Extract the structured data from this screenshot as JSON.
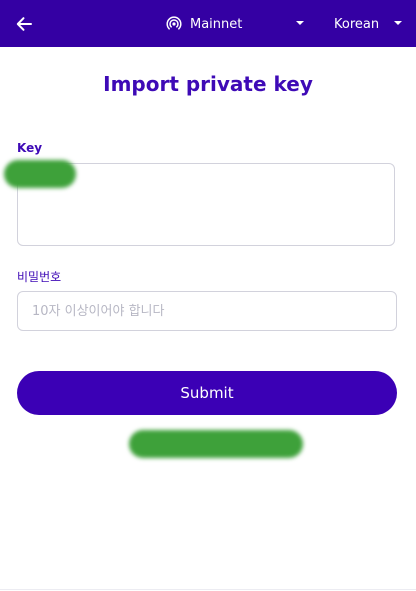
{
  "header": {
    "back_icon": "arrow-left-icon",
    "network": {
      "icon": "broadcast-icon",
      "label": "Mainnet"
    },
    "language": {
      "label": "Korean"
    }
  },
  "page": {
    "title": "Import private key"
  },
  "form": {
    "key_label": "Key",
    "key_value": "",
    "password_label": "비밀번호",
    "password_placeholder": "10자 이상이어야 합니다",
    "password_value": "",
    "submit_label": "Submit"
  },
  "colors": {
    "header_bg": "#3400a3",
    "accent": "#3e0ab6",
    "button_bg": "#3b00b5"
  }
}
